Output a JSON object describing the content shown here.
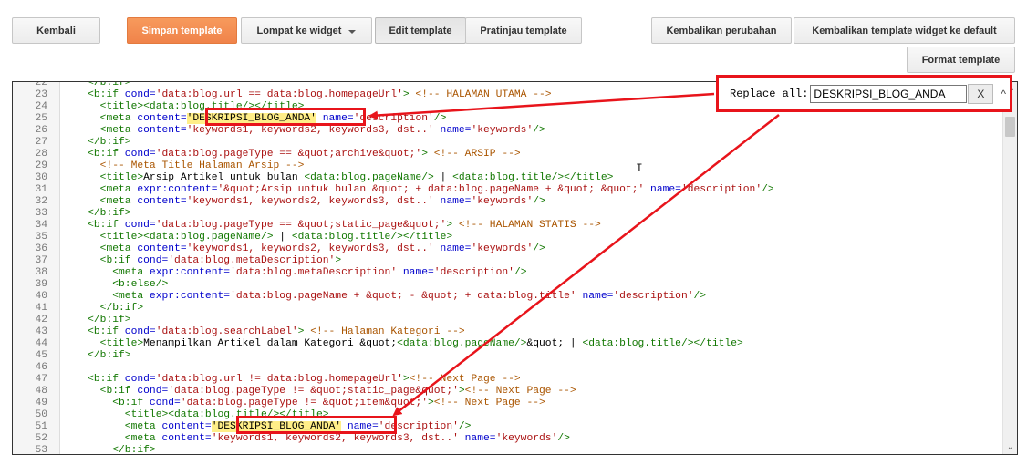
{
  "toolbar": {
    "back_label": "Kembali",
    "save_label": "Simpan template",
    "jump_label": "Lompat ke widget",
    "edit_label": "Edit template",
    "preview_label": "Pratinjau template",
    "revert_label": "Kembalikan perubahan",
    "reset_widget_label": "Kembalikan template widget ke default",
    "format_label": "Format template"
  },
  "replace": {
    "label": "Replace all:",
    "value": "DESKRIPSI_BLOG_ANDA",
    "close_label": "X",
    "caret": "^"
  },
  "colors": {
    "accent_orange": "#f0834a",
    "annotation_red": "#e8141b",
    "highlight": "#ffee88"
  },
  "editor": {
    "lines": [
      {
        "n": "22",
        "code": [
          {
            "t": "    </b:if>",
            "k": "tag"
          }
        ]
      },
      {
        "n": "23",
        "code": [
          {
            "t": "    <b:if ",
            "k": "tag"
          },
          {
            "t": "cond=",
            "k": "attr"
          },
          {
            "t": "'data:blog.url == data:blog.homepageUrl'",
            "k": "str"
          },
          {
            "t": ">",
            "k": "tag"
          },
          {
            "t": " <!-- HALAMAN UTAMA -->",
            "k": "com"
          }
        ]
      },
      {
        "n": "24",
        "code": [
          {
            "t": "      <title>",
            "k": "tag"
          },
          {
            "t": "<data:blog.title/>",
            "k": "tag"
          },
          {
            "t": "</title>",
            "k": "tag"
          }
        ]
      },
      {
        "n": "25",
        "code": [
          {
            "t": "      <meta ",
            "k": "tag"
          },
          {
            "t": "content=",
            "k": "attr"
          },
          {
            "t": "'DESKRIPSI_BLOG_ANDA'",
            "k": "hl"
          },
          {
            "t": " name=",
            "k": "attr"
          },
          {
            "t": "'description'",
            "k": "str"
          },
          {
            "t": "/>",
            "k": "tag"
          }
        ]
      },
      {
        "n": "26",
        "code": [
          {
            "t": "      <meta ",
            "k": "tag"
          },
          {
            "t": "content=",
            "k": "attr"
          },
          {
            "t": "'keywords1, keywords2, keywords3, dst..'",
            "k": "str"
          },
          {
            "t": " name=",
            "k": "attr"
          },
          {
            "t": "'keywords'",
            "k": "str"
          },
          {
            "t": "/>",
            "k": "tag"
          }
        ]
      },
      {
        "n": "27",
        "code": [
          {
            "t": "    </b:if>",
            "k": "tag"
          }
        ]
      },
      {
        "n": "28",
        "code": [
          {
            "t": "    <b:if ",
            "k": "tag"
          },
          {
            "t": "cond=",
            "k": "attr"
          },
          {
            "t": "'data:blog.pageType == &quot;archive&quot;'",
            "k": "str"
          },
          {
            "t": ">",
            "k": "tag"
          },
          {
            "t": " <!-- ARSIP -->",
            "k": "com"
          }
        ]
      },
      {
        "n": "29",
        "code": [
          {
            "t": "      <!-- Meta Title Halaman Arsip -->",
            "k": "com"
          }
        ]
      },
      {
        "n": "30",
        "code": [
          {
            "t": "      <title>",
            "k": "tag"
          },
          {
            "t": "Arsip Artikel untuk bulan ",
            "k": "plain"
          },
          {
            "t": "<data:blog.pageName/>",
            "k": "tag"
          },
          {
            "t": " | ",
            "k": "plain"
          },
          {
            "t": "<data:blog.title/>",
            "k": "tag"
          },
          {
            "t": "</title>",
            "k": "tag"
          }
        ]
      },
      {
        "n": "31",
        "code": [
          {
            "t": "      <meta ",
            "k": "tag"
          },
          {
            "t": "expr:content=",
            "k": "attr"
          },
          {
            "t": "'&quot;Arsip untuk bulan &quot; + data:blog.pageName + &quot; &quot;'",
            "k": "str"
          },
          {
            "t": " name=",
            "k": "attr"
          },
          {
            "t": "'description'",
            "k": "str"
          },
          {
            "t": "/>",
            "k": "tag"
          }
        ]
      },
      {
        "n": "32",
        "code": [
          {
            "t": "      <meta ",
            "k": "tag"
          },
          {
            "t": "content=",
            "k": "attr"
          },
          {
            "t": "'keywords1, keywords2, keywords3, dst..'",
            "k": "str"
          },
          {
            "t": " name=",
            "k": "attr"
          },
          {
            "t": "'keywords'",
            "k": "str"
          },
          {
            "t": "/>",
            "k": "tag"
          }
        ]
      },
      {
        "n": "33",
        "code": [
          {
            "t": "    </b:if>",
            "k": "tag"
          }
        ]
      },
      {
        "n": "34",
        "code": [
          {
            "t": "    <b:if ",
            "k": "tag"
          },
          {
            "t": "cond=",
            "k": "attr"
          },
          {
            "t": "'data:blog.pageType == &quot;static_page&quot;'",
            "k": "str"
          },
          {
            "t": ">",
            "k": "tag"
          },
          {
            "t": " <!-- HALAMAN STATIS -->",
            "k": "com"
          }
        ]
      },
      {
        "n": "35",
        "code": [
          {
            "t": "      <title>",
            "k": "tag"
          },
          {
            "t": "<data:blog.pageName/>",
            "k": "tag"
          },
          {
            "t": " | ",
            "k": "plain"
          },
          {
            "t": "<data:blog.title/>",
            "k": "tag"
          },
          {
            "t": "</title>",
            "k": "tag"
          }
        ]
      },
      {
        "n": "36",
        "code": [
          {
            "t": "      <meta ",
            "k": "tag"
          },
          {
            "t": "content=",
            "k": "attr"
          },
          {
            "t": "'keywords1, keywords2, keywords3, dst..'",
            "k": "str"
          },
          {
            "t": " name=",
            "k": "attr"
          },
          {
            "t": "'keywords'",
            "k": "str"
          },
          {
            "t": "/>",
            "k": "tag"
          }
        ]
      },
      {
        "n": "37",
        "code": [
          {
            "t": "      <b:if ",
            "k": "tag"
          },
          {
            "t": "cond=",
            "k": "attr"
          },
          {
            "t": "'data:blog.metaDescription'",
            "k": "str"
          },
          {
            "t": ">",
            "k": "tag"
          }
        ]
      },
      {
        "n": "38",
        "code": [
          {
            "t": "        <meta ",
            "k": "tag"
          },
          {
            "t": "expr:content=",
            "k": "attr"
          },
          {
            "t": "'data:blog.metaDescription'",
            "k": "str"
          },
          {
            "t": " name=",
            "k": "attr"
          },
          {
            "t": "'description'",
            "k": "str"
          },
          {
            "t": "/>",
            "k": "tag"
          }
        ]
      },
      {
        "n": "39",
        "code": [
          {
            "t": "        <b:else/>",
            "k": "tag"
          }
        ]
      },
      {
        "n": "40",
        "code": [
          {
            "t": "        <meta ",
            "k": "tag"
          },
          {
            "t": "expr:content=",
            "k": "attr"
          },
          {
            "t": "'data:blog.pageName + &quot; - &quot; + data:blog.title'",
            "k": "str"
          },
          {
            "t": " name=",
            "k": "attr"
          },
          {
            "t": "'description'",
            "k": "str"
          },
          {
            "t": "/>",
            "k": "tag"
          }
        ]
      },
      {
        "n": "41",
        "code": [
          {
            "t": "      </b:if>",
            "k": "tag"
          }
        ]
      },
      {
        "n": "42",
        "code": [
          {
            "t": "    </b:if>",
            "k": "tag"
          }
        ]
      },
      {
        "n": "43",
        "code": [
          {
            "t": "    <b:if ",
            "k": "tag"
          },
          {
            "t": "cond=",
            "k": "attr"
          },
          {
            "t": "'data:blog.searchLabel'",
            "k": "str"
          },
          {
            "t": ">",
            "k": "tag"
          },
          {
            "t": " <!-- Halaman Kategori -->",
            "k": "com"
          }
        ]
      },
      {
        "n": "44",
        "code": [
          {
            "t": "      <title>",
            "k": "tag"
          },
          {
            "t": "Menampilkan Artikel dalam Kategori &quot;",
            "k": "plain"
          },
          {
            "t": "<data:blog.pageName/>",
            "k": "tag"
          },
          {
            "t": "&quot; | ",
            "k": "plain"
          },
          {
            "t": "<data:blog.title/>",
            "k": "tag"
          },
          {
            "t": "</title>",
            "k": "tag"
          }
        ]
      },
      {
        "n": "45",
        "code": [
          {
            "t": "    </b:if>",
            "k": "tag"
          }
        ]
      },
      {
        "n": "46",
        "code": [
          {
            "t": "",
            "k": "plain"
          }
        ]
      },
      {
        "n": "47",
        "code": [
          {
            "t": "    <b:if ",
            "k": "tag"
          },
          {
            "t": "cond=",
            "k": "attr"
          },
          {
            "t": "'data:blog.url != data:blog.homepageUrl'",
            "k": "str"
          },
          {
            "t": ">",
            "k": "tag"
          },
          {
            "t": "<!-- Next Page -->",
            "k": "com"
          }
        ]
      },
      {
        "n": "48",
        "code": [
          {
            "t": "      <b:if ",
            "k": "tag"
          },
          {
            "t": "cond=",
            "k": "attr"
          },
          {
            "t": "'data:blog.pageType != &quot;static_page&quot;'",
            "k": "str"
          },
          {
            "t": ">",
            "k": "tag"
          },
          {
            "t": "<!-- Next Page -->",
            "k": "com"
          }
        ]
      },
      {
        "n": "49",
        "code": [
          {
            "t": "        <b:if ",
            "k": "tag"
          },
          {
            "t": "cond=",
            "k": "attr"
          },
          {
            "t": "'data:blog.pageType != &quot;item&quot;'",
            "k": "str"
          },
          {
            "t": ">",
            "k": "tag"
          },
          {
            "t": "<!-- Next Page -->",
            "k": "com"
          }
        ]
      },
      {
        "n": "50",
        "code": [
          {
            "t": "          <title>",
            "k": "tag"
          },
          {
            "t": "<data:blog.title/>",
            "k": "tag"
          },
          {
            "t": "</title>",
            "k": "tag"
          }
        ]
      },
      {
        "n": "51",
        "code": [
          {
            "t": "          <meta ",
            "k": "tag"
          },
          {
            "t": "content=",
            "k": "attr"
          },
          {
            "t": "'DESKRIPSI_BLOG_ANDA'",
            "k": "hl"
          },
          {
            "t": " name=",
            "k": "attr"
          },
          {
            "t": "'description'",
            "k": "str"
          },
          {
            "t": "/>",
            "k": "tag"
          }
        ]
      },
      {
        "n": "52",
        "code": [
          {
            "t": "          <meta ",
            "k": "tag"
          },
          {
            "t": "content=",
            "k": "attr"
          },
          {
            "t": "'keywords1, keywords2, keywords3, dst..'",
            "k": "str"
          },
          {
            "t": " name=",
            "k": "attr"
          },
          {
            "t": "'keywords'",
            "k": "str"
          },
          {
            "t": "/>",
            "k": "tag"
          }
        ]
      },
      {
        "n": "53",
        "code": [
          {
            "t": "        </b:if>",
            "k": "tag"
          }
        ]
      }
    ]
  }
}
